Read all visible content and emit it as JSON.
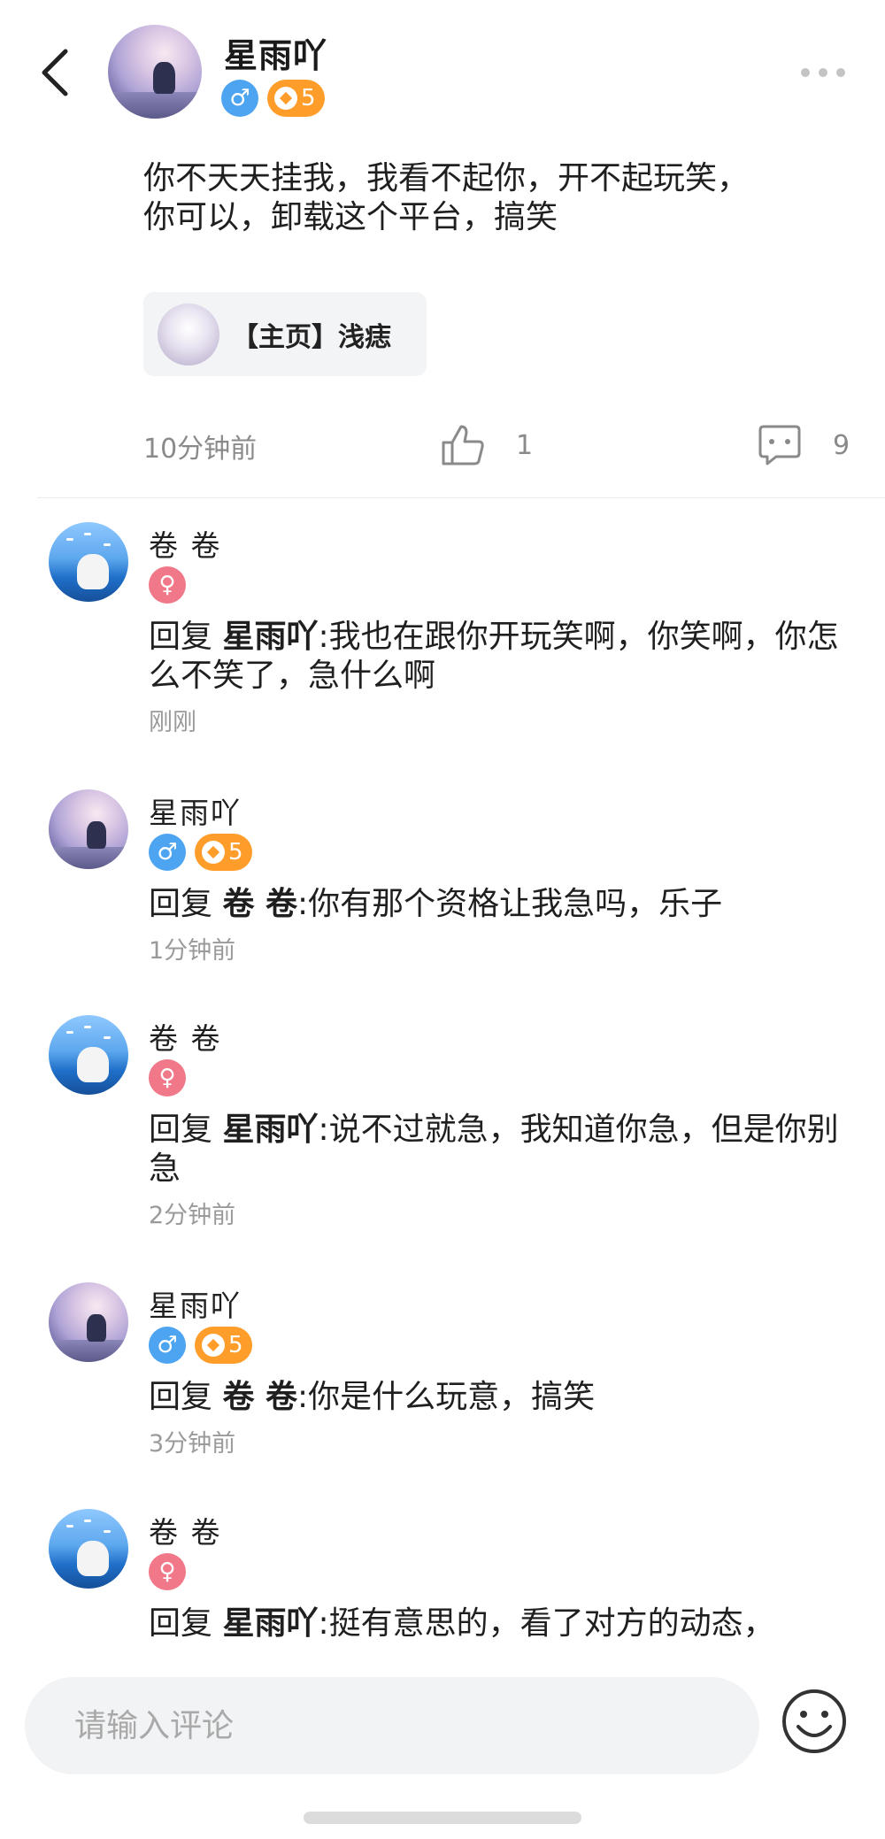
{
  "header": {
    "name": "星雨吖",
    "gender": "♂",
    "level": "5"
  },
  "post": {
    "text_line1": "你不天天挂我，我看不起你，开不起玩笑，",
    "text_line2": "你可以，卸载这个平台，搞笑",
    "link_card": {
      "title": "【主页】浅痣"
    },
    "time": "10分钟前",
    "likes": "1",
    "comments": "9"
  },
  "colors": {
    "male": "#4da4f0",
    "female": "#f07889",
    "level": "#ff9d2b"
  },
  "comments": [
    {
      "name": "卷 卷",
      "gender": "♀",
      "prefix": "回复 ",
      "target": "星雨吖",
      "text": ":我也在跟你开玩笑啊，你笑啊，你怎么不笑了，急什么啊",
      "time": "刚刚"
    },
    {
      "name": "星雨吖",
      "gender": "♂",
      "level": "5",
      "prefix": "回复 ",
      "target": "卷 卷",
      "text": ":你有那个资格让我急吗，乐子",
      "time": "1分钟前"
    },
    {
      "name": "卷 卷",
      "gender": "♀",
      "prefix": "回复 ",
      "target": "星雨吖",
      "text": ":说不过就急，我知道你急，但是你别急",
      "time": "2分钟前"
    },
    {
      "name": "星雨吖",
      "gender": "♂",
      "level": "5",
      "prefix": "回复 ",
      "target": "卷 卷",
      "text": ":你是什么玩意，搞笑",
      "time": "3分钟前"
    },
    {
      "name": "卷 卷",
      "gender": "♀",
      "prefix": "回复 ",
      "target": "星雨吖",
      "text": ":挺有意思的，看了对方的动态，"
    }
  ],
  "input": {
    "placeholder": "请输入评论"
  },
  "icons": {
    "back": "back-arrow-icon",
    "more": "more-dots-icon",
    "like": "thumbs-up-icon",
    "comment": "comment-bubble-icon",
    "emoji": "smiley-icon"
  }
}
